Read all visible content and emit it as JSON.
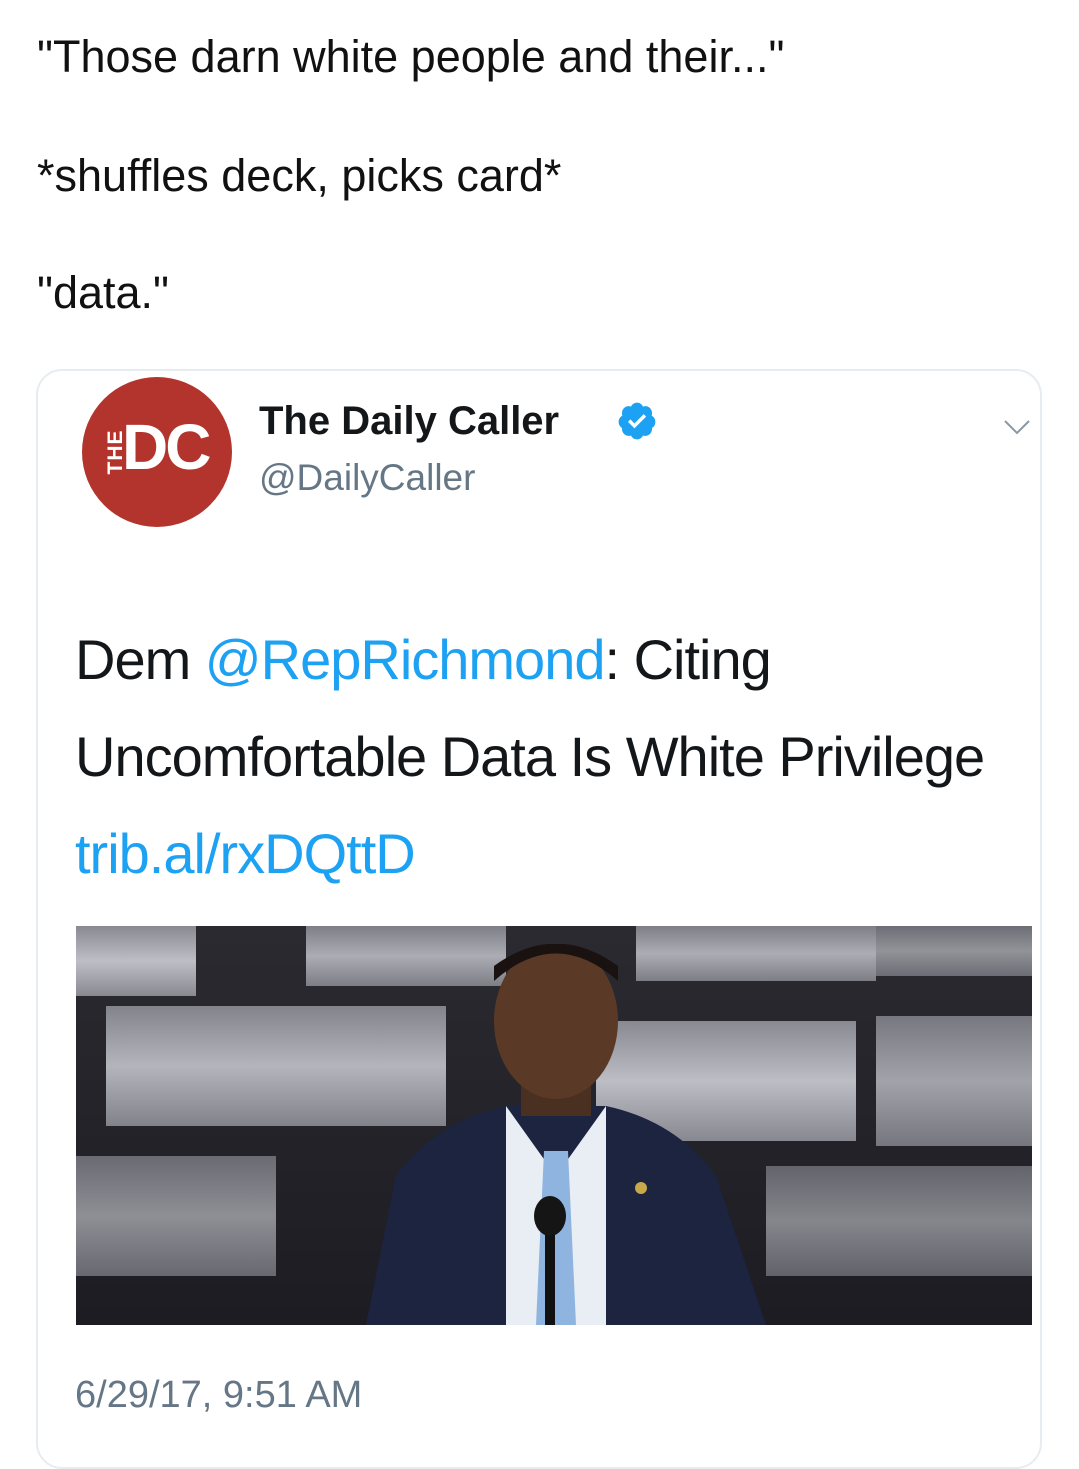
{
  "caption": {
    "line1": "\"Those darn white people and their...\"",
    "line2": "*shuffles deck, picks card*",
    "line3": "\"data.\""
  },
  "tweet": {
    "avatar_letters": "DC",
    "avatar_small_text": "THE",
    "display_name": "The Daily Caller",
    "verified": true,
    "handle": "@DailyCaller",
    "text_prefix": "Dem ",
    "mention": "@RepRichmond",
    "text_body": ": Citing Uncomfortable Data Is White Privilege ",
    "link": "trib.al/rxDQttD",
    "timestamp": "6/29/17, 9:51 AM",
    "icons": {
      "verified": "verified-badge-icon",
      "menu": "chevron-down-icon"
    },
    "colors": {
      "link": "#1da1f2",
      "avatar": "#b3342d",
      "muted": "#657786"
    }
  }
}
